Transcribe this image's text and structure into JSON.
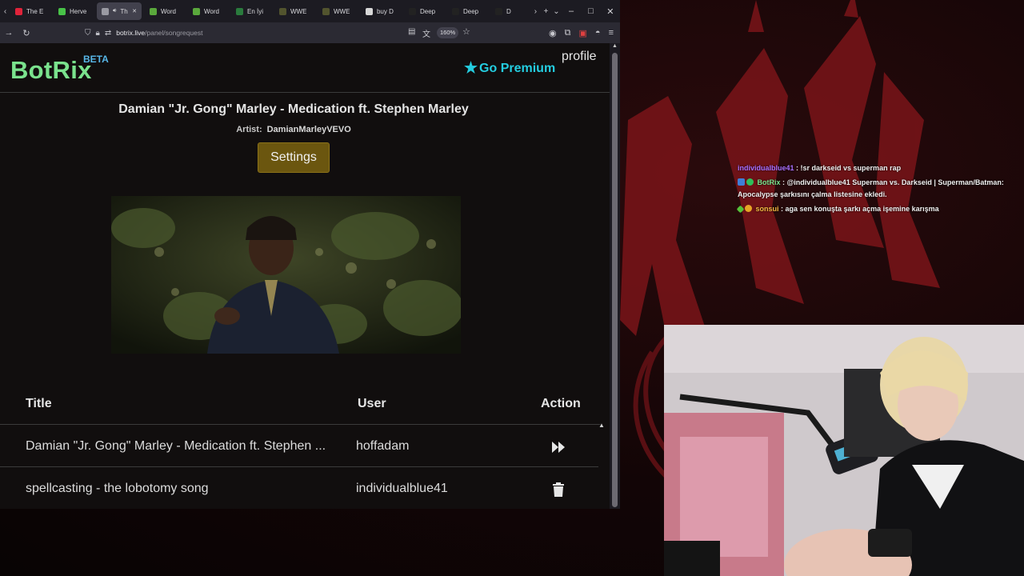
{
  "browser": {
    "tabs": [
      {
        "label": "The E",
        "color": "#e0233a"
      },
      {
        "label": "Herve",
        "color": "#48c248"
      },
      {
        "label": "The",
        "color": "#9a9aa3",
        "active": true
      },
      {
        "label": "Word",
        "color": "#5aa83c"
      },
      {
        "label": "Word",
        "color": "#5aa83c"
      },
      {
        "label": "En İyi",
        "color": "#2a7b3d"
      },
      {
        "label": "WWE",
        "color": "#52542e"
      },
      {
        "label": "WWE",
        "color": "#52542e"
      },
      {
        "label": "buy D",
        "color": "#d8d8d8"
      },
      {
        "label": "Deep",
        "color": "#222222"
      },
      {
        "label": "Deep",
        "color": "#222222"
      },
      {
        "label": "D",
        "color": "#222222"
      }
    ],
    "url": {
      "host": "botrix.live",
      "path": "/panel/songrequest"
    },
    "zoom": "160%",
    "window_controls": [
      "–",
      "□",
      "✕"
    ]
  },
  "header": {
    "logo": "BotRix",
    "logo_badge": "BETA",
    "premium": "Go Premium",
    "profile": "profile"
  },
  "now_playing": {
    "title": "Damian \"Jr. Gong\" Marley - Medication ft. Stephen Marley",
    "artist_label": "Artist:",
    "artist": "DamianMarleyVEVO",
    "settings_label": "Settings"
  },
  "queue": {
    "columns": {
      "title": "Title",
      "user": "User",
      "action": "Action"
    },
    "rows": [
      {
        "title": "Damian \"Jr. Gong\" Marley - Medication ft. Stephen ...",
        "user": "hoffadam",
        "action": "skip-icon"
      },
      {
        "title": "spellcasting - the lobotomy song",
        "user": "individualblue41",
        "action": "trash-icon"
      }
    ]
  },
  "chat": [
    {
      "user": "individualblue41",
      "user_color": "#a970ff",
      "text": "!sr darkseid vs superman rap"
    },
    {
      "user": "BotRix",
      "user_color": "#7ae28d",
      "text": "@individualblue41 Superman vs. Darkseid | Superman/Batman: Apocalypse şarkısını çalma listesine ekledi."
    },
    {
      "user": "sonsui",
      "user_color": "#f4b942",
      "text": "aga sen konuşta şarkı açma işemine karışma"
    }
  ],
  "colors": {
    "accent_green": "#7ae28d",
    "premium_cyan": "#24cde0",
    "beta_blue": "#58b7e8",
    "settings_gold": "#6b560f"
  }
}
